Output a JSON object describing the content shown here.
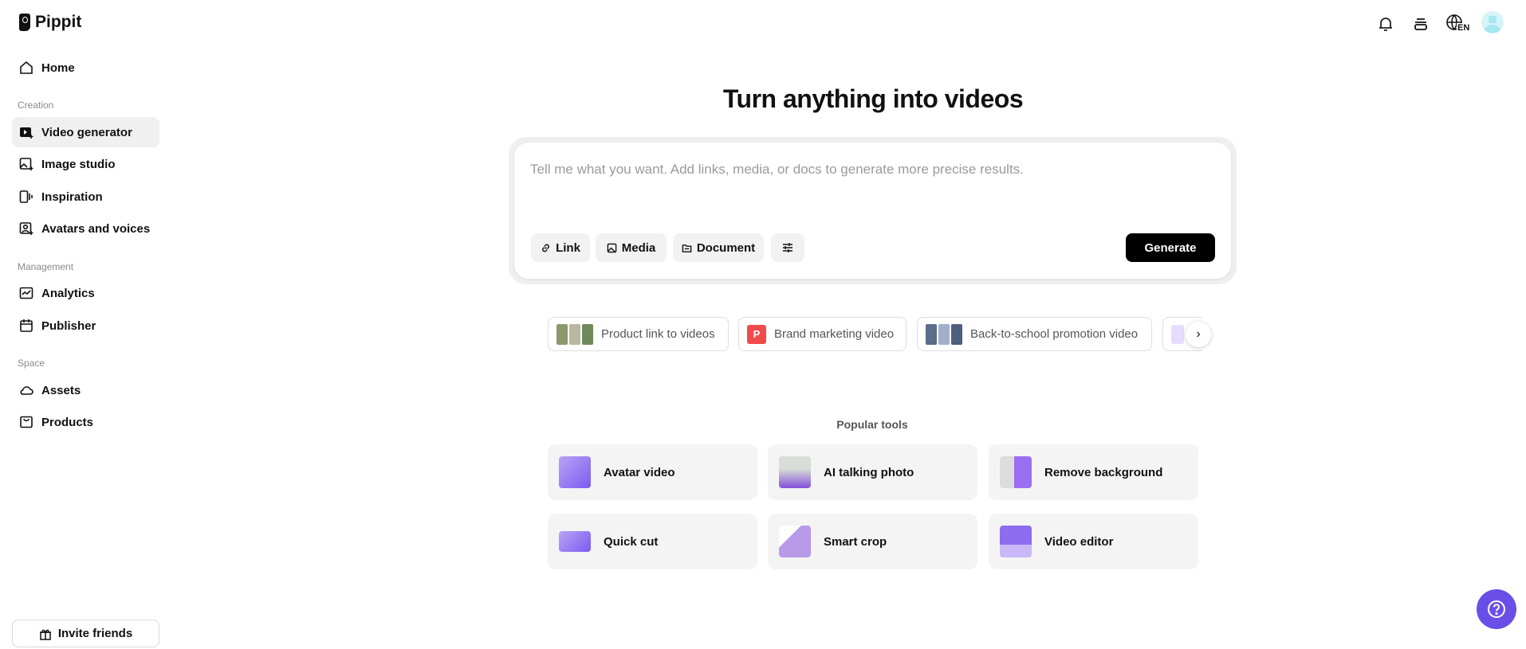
{
  "brand": {
    "name": "Pippit"
  },
  "sidebar": {
    "home": "Home",
    "sections": {
      "creation": "Creation",
      "management": "Management",
      "space": "Space"
    },
    "items": [
      {
        "label": "Video generator",
        "icon": "video-plus-icon",
        "active": true
      },
      {
        "label": "Image studio",
        "icon": "image-plus-icon"
      },
      {
        "label": "Inspiration",
        "icon": "inspiration-icon"
      },
      {
        "label": "Avatars and voices",
        "icon": "avatar-icon"
      },
      {
        "label": "Analytics",
        "icon": "chart-line-icon"
      },
      {
        "label": "Publisher",
        "icon": "calendar-icon"
      },
      {
        "label": "Assets",
        "icon": "cloud-icon"
      },
      {
        "label": "Products",
        "icon": "bag-icon"
      }
    ],
    "invite": "Invite friends"
  },
  "header": {
    "language": "EN"
  },
  "main": {
    "title": "Turn anything into videos",
    "prompt_placeholder": "Tell me what you want. Add links, media, or docs to generate more precise results.",
    "buttons": {
      "link": "Link",
      "media": "Media",
      "document": "Document",
      "generate": "Generate"
    },
    "chips": [
      {
        "label": "Product link to videos"
      },
      {
        "label": "Brand marketing video",
        "badge": "P"
      },
      {
        "label": "Back-to-school promotion video"
      }
    ],
    "popular_label": "Popular tools",
    "tools": [
      "Avatar video",
      "AI talking photo",
      "Remove background",
      "Quick cut",
      "Smart crop",
      "Video editor"
    ]
  },
  "colors": {
    "accent": "#6a4ee8",
    "brand_badge": "#f04b4b"
  }
}
